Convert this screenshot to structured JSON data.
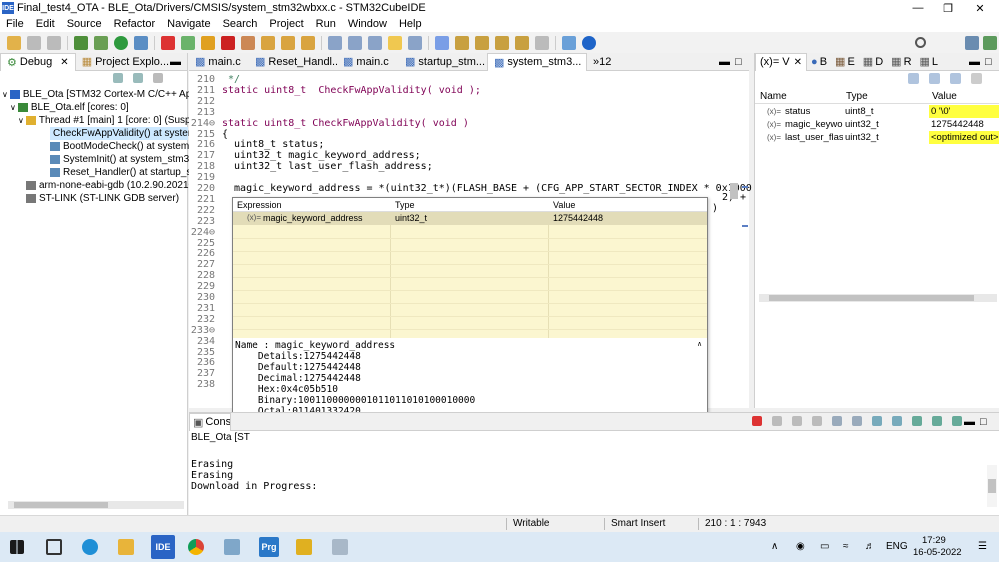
{
  "window": {
    "title": "Final_test4_OTA - BLE_Ota/Drivers/CMSIS/system_stm32wbxx.c - STM32CubeIDE",
    "app_badge": "IDE"
  },
  "menu": [
    "File",
    "Edit",
    "Source",
    "Refactor",
    "Navigate",
    "Search",
    "Project",
    "Run",
    "Window",
    "Help"
  ],
  "debug_panel": {
    "tabs": [
      "Debug",
      "Project Explo..."
    ],
    "tree": [
      {
        "label": "BLE_Ota [STM32 Cortex-M C/C++ Appli"
      },
      {
        "label": "BLE_Ota.elf [cores: 0]"
      },
      {
        "label": "Thread #1 [main] 1 [core: 0] (Suspe"
      },
      {
        "label": "CheckFwAppValidity() at system"
      },
      {
        "label": "BootModeCheck() at system_st"
      },
      {
        "label": "SystemInit() at system_stm32wl"
      },
      {
        "label": "Reset_Handler() at startup_stm3"
      },
      {
        "label": "arm-none-eabi-gdb (10.2.90.2021062"
      },
      {
        "label": "ST-LINK (ST-LINK GDB server)"
      }
    ]
  },
  "editor": {
    "tabs": [
      "main.c",
      "Reset_Handl...",
      "main.c",
      "startup_stm...",
      "system_stm3...",
      "»12"
    ],
    "lines": [
      {
        "n": "210",
        "t": " */"
      },
      {
        "n": "211",
        "t": "static uint8_t  CheckFwAppValidity( void );"
      },
      {
        "n": "212",
        "t": ""
      },
      {
        "n": "213",
        "t": ""
      },
      {
        "n": "214⊖",
        "t": "static uint8_t CheckFwAppValidity( void )"
      },
      {
        "n": "215",
        "t": "{"
      },
      {
        "n": "216",
        "t": "  uint8_t status;"
      },
      {
        "n": "217",
        "t": "  uint32_t magic_keyword_address;"
      },
      {
        "n": "218",
        "t": "  uint32_t last_user_flash_address;"
      },
      {
        "n": "219",
        "t": ""
      },
      {
        "n": "220",
        "t": "  magic_keyword_address = *(uint32_t*)(FLASH_BASE + (CFG_APP_START_SECTOR_INDEX * 0x1000 + 0x140));"
      },
      {
        "n": "221",
        "t": ""
      },
      {
        "n": "222",
        "t": ""
      },
      {
        "n": "223",
        "t": ""
      },
      {
        "n": "224⊖",
        "t": ""
      },
      {
        "n": "225",
        "t": ""
      },
      {
        "n": "226",
        "t": ""
      },
      {
        "n": "227",
        "t": ""
      },
      {
        "n": "228",
        "t": ""
      },
      {
        "n": "229",
        "t": ""
      },
      {
        "n": "230",
        "t": ""
      },
      {
        "n": "231",
        "t": ""
      },
      {
        "n": "232",
        "t": ""
      },
      {
        "n": "233⊖",
        "t": ""
      },
      {
        "n": "234",
        "t": ""
      },
      {
        "n": "235",
        "t": ""
      },
      {
        "n": "236",
        "t": ""
      },
      {
        "n": "237",
        "t": ""
      },
      {
        "n": "238",
        "t": ""
      }
    ],
    "clipped_right_1": "2) +",
    "clipped_right_2": ")"
  },
  "popup": {
    "headers": [
      "Expression",
      "Type",
      "Value"
    ],
    "row": {
      "expression": "magic_keyword_address",
      "type": "uint32_t",
      "value": "1275442448"
    },
    "detail": [
      "Name : magic_keyword_address",
      "    Details:1275442448",
      "    Default:1275442448",
      "    Decimal:1275442448",
      "    Hex:0x4c05b510",
      "    Binary:1001100000001011011010100010000",
      "    Octal:011401332420"
    ]
  },
  "variables_panel": {
    "tabs": [
      "(x)= V",
      "B",
      "E",
      "D",
      "R",
      "L"
    ],
    "headers": [
      "Name",
      "Type",
      "Value"
    ],
    "rows": [
      {
        "name": "status",
        "type": "uint8_t",
        "value": "0 '\\0'",
        "highlight": true
      },
      {
        "name": "magic_keywor",
        "type": "uint32_t",
        "value": "1275442448",
        "highlight": false
      },
      {
        "name": "last_user_flash_",
        "type": "uint32_t",
        "value": "<optimized out>",
        "highlight": true
      }
    ]
  },
  "console": {
    "tab": "Conso",
    "header": "BLE_Ota [ST",
    "lines": [
      "",
      "Erasing",
      "Erasing",
      "Download in Progress:"
    ]
  },
  "statusbar": {
    "writable": "Writable",
    "insert_mode": "Smart Insert",
    "position": "210 : 1 : 7943"
  },
  "taskbar": {
    "time": "17:29",
    "date": "16-05-2022",
    "lang": "ENG"
  },
  "colors": {
    "highlight_yellow": "#ffff40",
    "popup_bg": "#fbf6d0",
    "keyword": "#7f0055"
  }
}
